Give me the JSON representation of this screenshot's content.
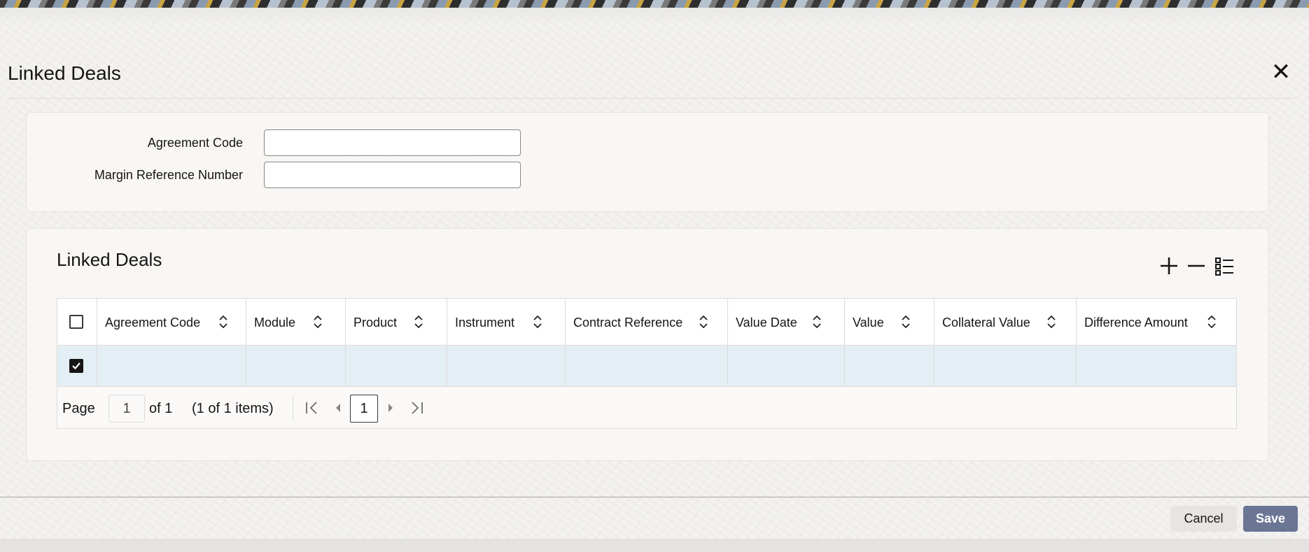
{
  "dialog": {
    "title": "Linked Deals",
    "close_icon": "close-icon"
  },
  "form": {
    "agreement_code_label": "Agreement Code",
    "agreement_code_value": "",
    "margin_reference_label": "Margin Reference Number",
    "margin_reference_value": ""
  },
  "grid": {
    "title": "Linked Deals",
    "toolbar_icons": [
      "add-icon",
      "remove-icon",
      "column-list-icon"
    ],
    "columns": [
      "Agreement Code",
      "Module",
      "Product",
      "Instrument",
      "Contract Reference",
      "Value Date",
      "Value",
      "Collateral Value",
      "Difference Amount"
    ],
    "header_checkbox_checked": false,
    "rows": [
      {
        "checked": true,
        "cells": [
          "",
          "",
          "",
          "",
          "",
          "",
          "",
          "",
          ""
        ]
      }
    ]
  },
  "pager": {
    "page_label": "Page",
    "page_value": "1",
    "of_text": "of 1",
    "items_text": "(1 of 1 items)",
    "current_page": "1",
    "nav_icons": [
      "first-page-icon",
      "previous-page-icon",
      "next-page-icon",
      "last-page-icon"
    ]
  },
  "footer": {
    "cancel_label": "Cancel",
    "save_label": "Save",
    "save_color": "#6b7594"
  }
}
